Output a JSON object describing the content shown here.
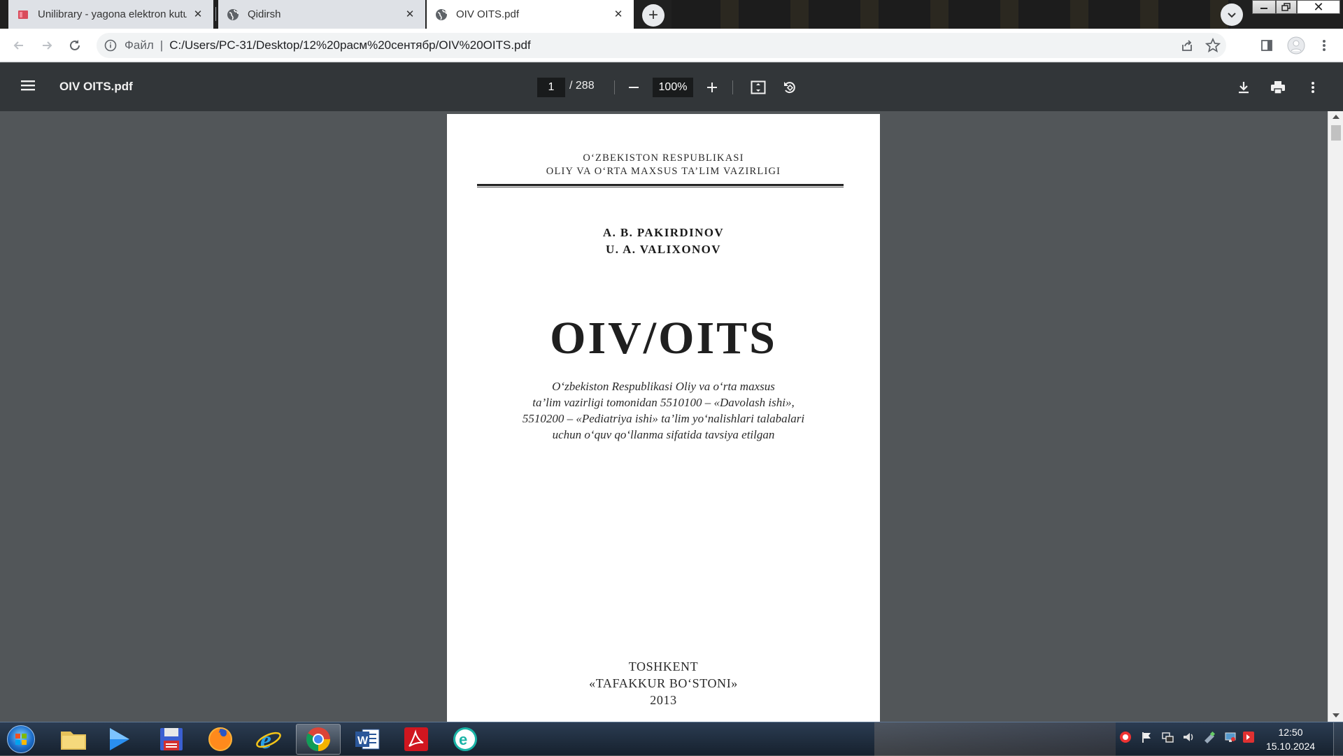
{
  "browser": {
    "tabs": [
      {
        "title": "Unilibrary - yagona elektron kutubxona",
        "icon": "unilibrary-favicon-icon",
        "active": false
      },
      {
        "title": "Qidirsh",
        "icon": "globe-icon",
        "active": false
      },
      {
        "title": "OIV OITS.pdf",
        "icon": "globe-icon",
        "active": true
      }
    ],
    "address": {
      "scheme_label": "Файл",
      "url": "C:/Users/PC-31/Desktop/12%20расм%20сентябр/OIV%20OITS.pdf"
    }
  },
  "pdf_toolbar": {
    "title": "OIV OITS.pdf",
    "current_page": "1",
    "total_pages": "/ 288",
    "zoom": "100%"
  },
  "page_content": {
    "ministry_line1": "O‘ZBEKISTON RESPUBLIKASI",
    "ministry_line2": "OLIY VA O‘RTA MAXSUS TA’LIM VAZIRLIGI",
    "author1": "A. B. PAKIRDINOV",
    "author2": "U. A. VALIXONOV",
    "book_title": "OIV/OITS",
    "approval_lines": [
      "O‘zbekiston Respublikasi Oliy va o‘rta maxsus",
      "ta’lim vazirligi tomonidan 5510100 – «Davolash ishi»,",
      "5510200 – «Pediatriya ishi» ta’lim yo‘nalishlari talabalari",
      "uchun o‘quv qo‘llanma sifatida tavsiya etilgan"
    ],
    "city": "TOSHKENT",
    "publisher": "«TAFAKKUR BO‘STONI»",
    "year": "2013"
  },
  "taskbar": {
    "apps": [
      "file-explorer-icon",
      "media-player-icon",
      "save-disk-icon",
      "firefox-icon",
      "internet-explorer-icon",
      "chrome-icon",
      "word-icon",
      "acrobat-icon",
      "eset-icon"
    ],
    "clock_time": "12:50",
    "clock_date": "15.10.2024"
  },
  "colors": {
    "pdf_toolbar_bg": "#323639",
    "viewer_bg": "#525659",
    "tab_active_bg": "#ffffff",
    "tab_inactive_bg": "#dee1e6"
  }
}
